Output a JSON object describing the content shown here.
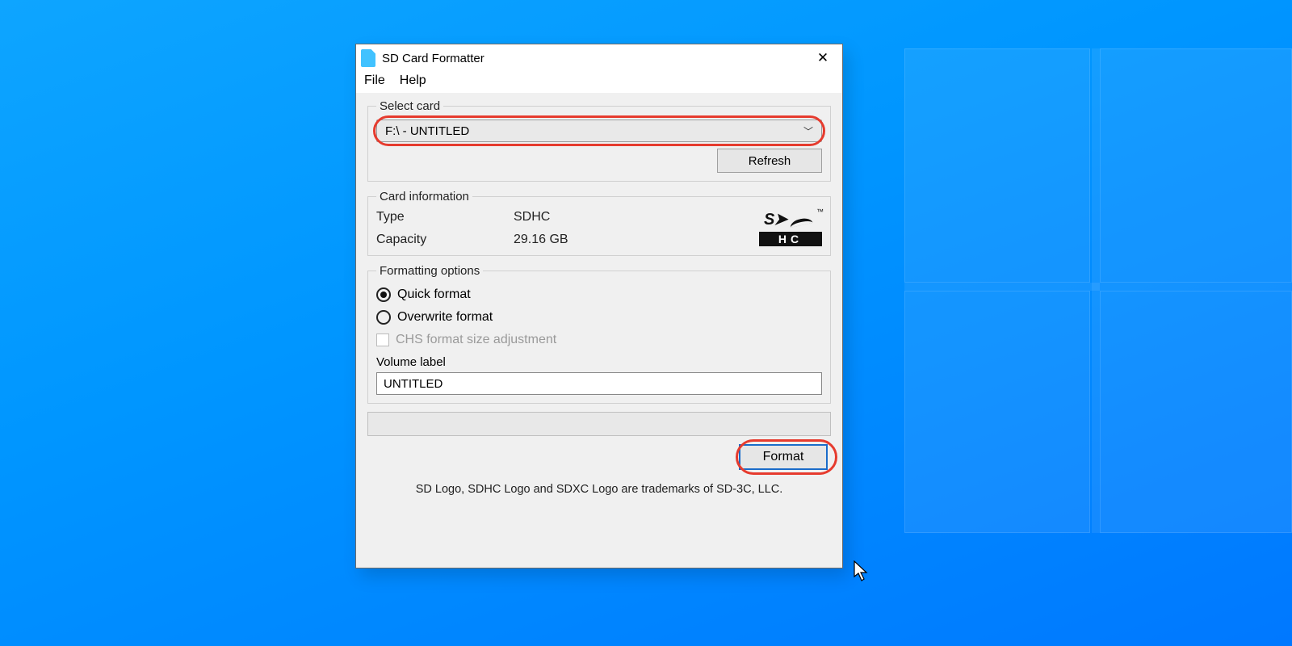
{
  "window": {
    "title": "SD Card Formatter",
    "menu": {
      "file": "File",
      "help": "Help"
    }
  },
  "select_card": {
    "legend": "Select card",
    "value": "F:\\ - UNTITLED",
    "refresh": "Refresh"
  },
  "card_info": {
    "legend": "Card information",
    "type_label": "Type",
    "type_value": "SDHC",
    "capacity_label": "Capacity",
    "capacity_value": "29.16 GB",
    "logo_sd": "S",
    "logo_hc": "HC",
    "logo_tm": "™"
  },
  "formatting": {
    "legend": "Formatting options",
    "quick": "Quick format",
    "overwrite": "Overwrite format",
    "chs": "CHS format size adjustment",
    "selected": "quick",
    "volume_label_caption": "Volume label",
    "volume_label_value": "UNTITLED"
  },
  "actions": {
    "format": "Format"
  },
  "footer": {
    "trademark": "SD Logo, SDHC Logo and SDXC Logo are trademarks of SD-3C, LLC."
  }
}
